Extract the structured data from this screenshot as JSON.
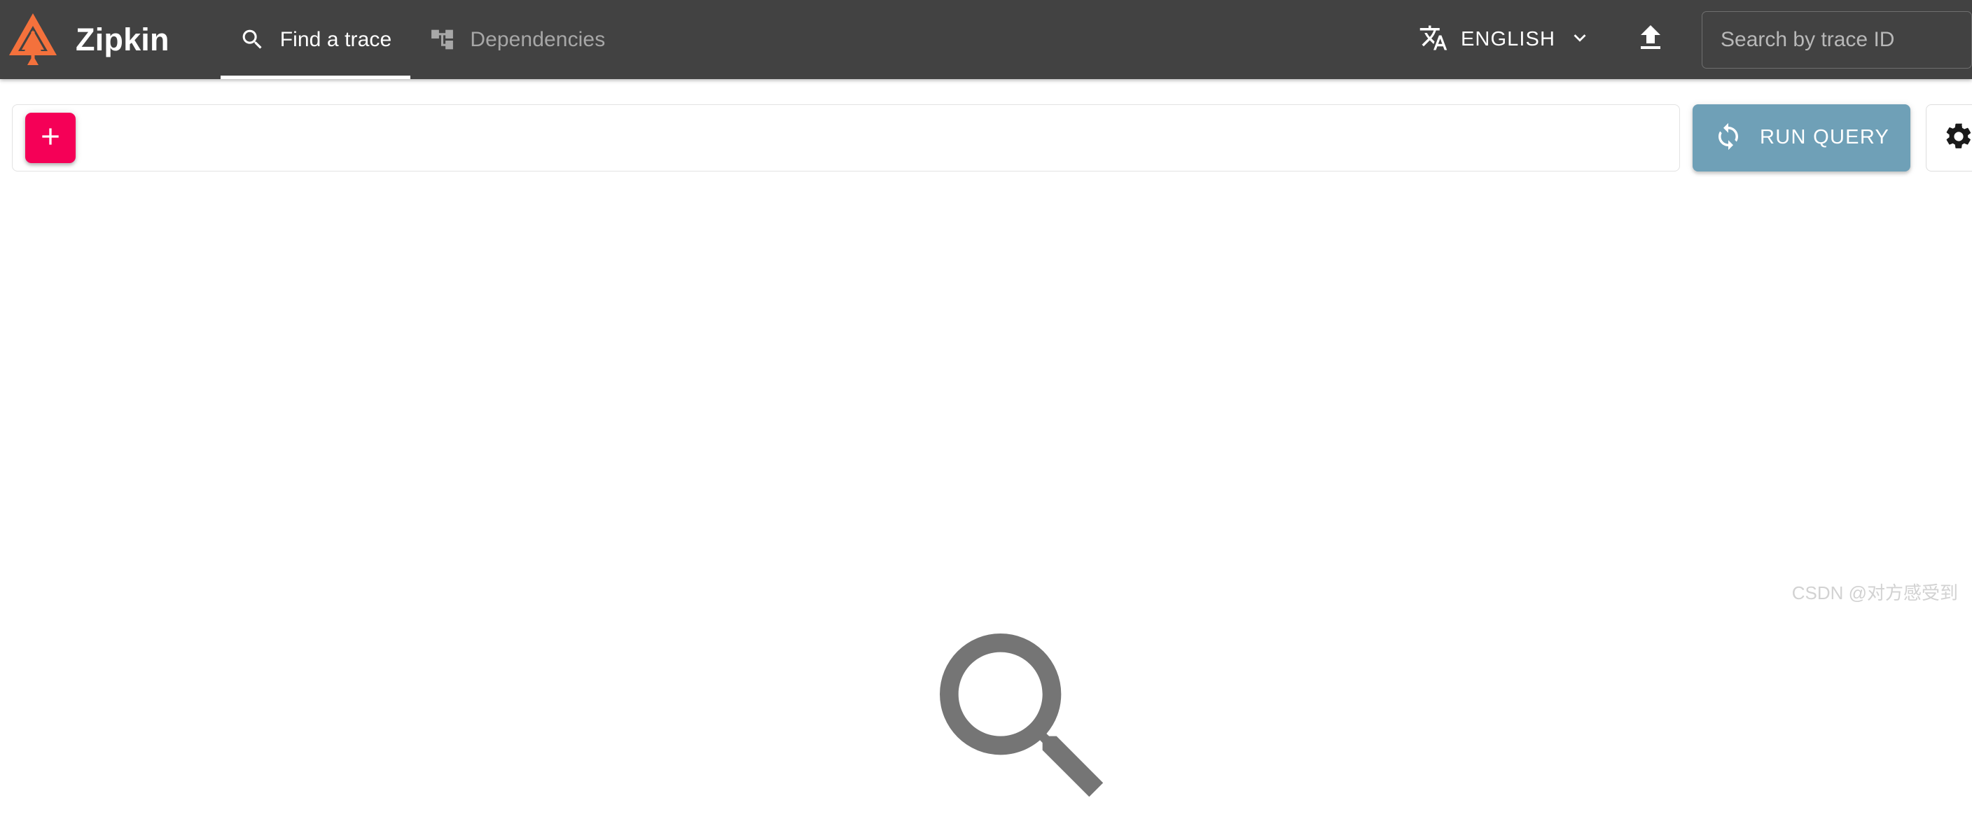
{
  "app": {
    "brand_title": "Zipkin",
    "logo_icon": "zipkin-logo-icon"
  },
  "header": {
    "tabs": [
      {
        "label": "Find a trace",
        "icon": "search-icon",
        "active": true
      },
      {
        "label": "Dependencies",
        "icon": "account-tree-icon",
        "active": false
      }
    ],
    "language": {
      "label": "ENGLISH",
      "icon": "translate-icon",
      "chevron_icon": "chevron-down-icon"
    },
    "upload": {
      "icon": "upload-icon"
    },
    "trace_search": {
      "placeholder": "Search by trace ID",
      "value": ""
    }
  },
  "querybar": {
    "add_criterion": {
      "label": "+",
      "icon": "plus-icon"
    },
    "run_query": {
      "label": "RUN QUERY",
      "icon": "refresh-icon"
    },
    "settings": {
      "icon": "gear-icon",
      "chevron_icon": "chevron-down-icon"
    }
  },
  "main": {
    "empty_state_icon": "magnifier-icon"
  },
  "watermark": {
    "text": "CSDN @对方感受到"
  },
  "colors": {
    "appbar_bg": "#424242",
    "accent_pink": "#f50057",
    "run_query_blue": "#6fa0b7",
    "logo_orange": "#f4713c",
    "empty_icon_gray": "#757575",
    "inactive_tab": "#a7a7a7"
  }
}
